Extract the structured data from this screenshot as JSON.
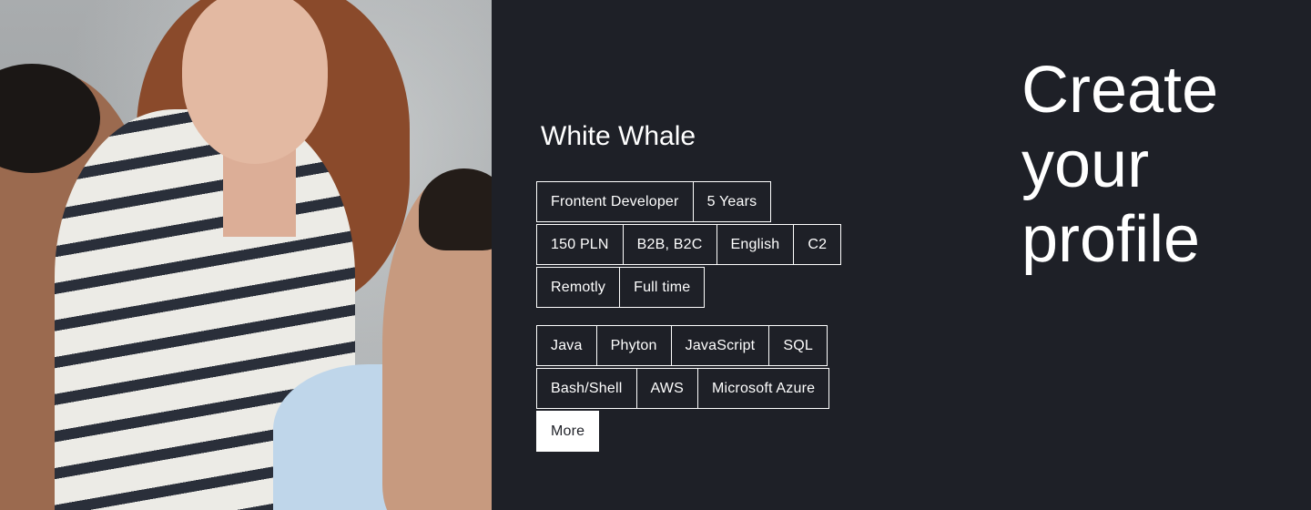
{
  "photo": {
    "icon": "team-photo"
  },
  "profile": {
    "name": "White Whale",
    "attributes_row1": [
      "Frontent Developer",
      "5 Years"
    ],
    "attributes_row2": [
      "150 PLN",
      "B2B, B2C",
      "English",
      "C2"
    ],
    "attributes_row3": [
      "Remotly",
      "Full time"
    ],
    "skills_row1": [
      "Java",
      "Phyton",
      "JavaScript",
      "SQL"
    ],
    "skills_row2": [
      "Bash/Shell",
      "AWS",
      "Microsoft Azure"
    ],
    "more_label": "More"
  },
  "headline": {
    "line1": "Create",
    "line2": "your",
    "line3": "profile"
  },
  "colors": {
    "background": "#1e2027",
    "text": "#ffffff"
  }
}
